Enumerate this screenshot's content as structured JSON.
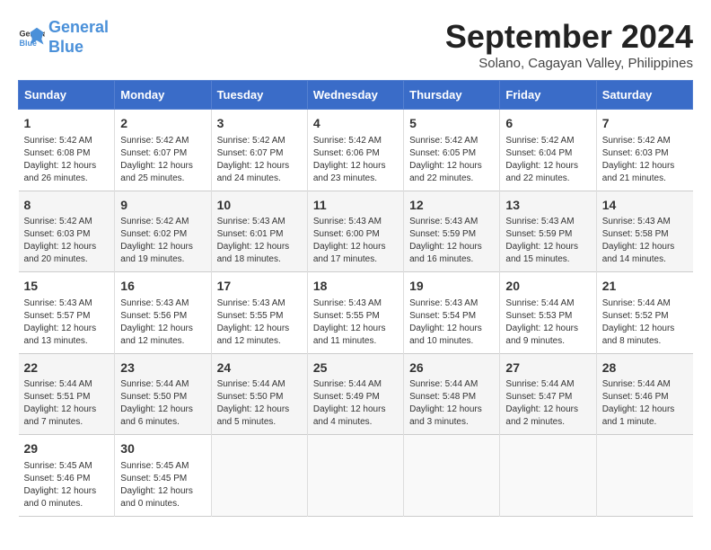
{
  "logo": {
    "line1": "General",
    "line2": "Blue"
  },
  "title": "September 2024",
  "subtitle": "Solano, Cagayan Valley, Philippines",
  "weekdays": [
    "Sunday",
    "Monday",
    "Tuesday",
    "Wednesday",
    "Thursday",
    "Friday",
    "Saturday"
  ],
  "weeks": [
    [
      {
        "day": 1,
        "sunrise": "5:42 AM",
        "sunset": "6:08 PM",
        "daylight": "12 hours and 26 minutes."
      },
      {
        "day": 2,
        "sunrise": "5:42 AM",
        "sunset": "6:07 PM",
        "daylight": "12 hours and 25 minutes."
      },
      {
        "day": 3,
        "sunrise": "5:42 AM",
        "sunset": "6:07 PM",
        "daylight": "12 hours and 24 minutes."
      },
      {
        "day": 4,
        "sunrise": "5:42 AM",
        "sunset": "6:06 PM",
        "daylight": "12 hours and 23 minutes."
      },
      {
        "day": 5,
        "sunrise": "5:42 AM",
        "sunset": "6:05 PM",
        "daylight": "12 hours and 22 minutes."
      },
      {
        "day": 6,
        "sunrise": "5:42 AM",
        "sunset": "6:04 PM",
        "daylight": "12 hours and 22 minutes."
      },
      {
        "day": 7,
        "sunrise": "5:42 AM",
        "sunset": "6:03 PM",
        "daylight": "12 hours and 21 minutes."
      }
    ],
    [
      {
        "day": 8,
        "sunrise": "5:42 AM",
        "sunset": "6:03 PM",
        "daylight": "12 hours and 20 minutes."
      },
      {
        "day": 9,
        "sunrise": "5:42 AM",
        "sunset": "6:02 PM",
        "daylight": "12 hours and 19 minutes."
      },
      {
        "day": 10,
        "sunrise": "5:43 AM",
        "sunset": "6:01 PM",
        "daylight": "12 hours and 18 minutes."
      },
      {
        "day": 11,
        "sunrise": "5:43 AM",
        "sunset": "6:00 PM",
        "daylight": "12 hours and 17 minutes."
      },
      {
        "day": 12,
        "sunrise": "5:43 AM",
        "sunset": "5:59 PM",
        "daylight": "12 hours and 16 minutes."
      },
      {
        "day": 13,
        "sunrise": "5:43 AM",
        "sunset": "5:59 PM",
        "daylight": "12 hours and 15 minutes."
      },
      {
        "day": 14,
        "sunrise": "5:43 AM",
        "sunset": "5:58 PM",
        "daylight": "12 hours and 14 minutes."
      }
    ],
    [
      {
        "day": 15,
        "sunrise": "5:43 AM",
        "sunset": "5:57 PM",
        "daylight": "12 hours and 13 minutes."
      },
      {
        "day": 16,
        "sunrise": "5:43 AM",
        "sunset": "5:56 PM",
        "daylight": "12 hours and 12 minutes."
      },
      {
        "day": 17,
        "sunrise": "5:43 AM",
        "sunset": "5:55 PM",
        "daylight": "12 hours and 12 minutes."
      },
      {
        "day": 18,
        "sunrise": "5:43 AM",
        "sunset": "5:55 PM",
        "daylight": "12 hours and 11 minutes."
      },
      {
        "day": 19,
        "sunrise": "5:43 AM",
        "sunset": "5:54 PM",
        "daylight": "12 hours and 10 minutes."
      },
      {
        "day": 20,
        "sunrise": "5:44 AM",
        "sunset": "5:53 PM",
        "daylight": "12 hours and 9 minutes."
      },
      {
        "day": 21,
        "sunrise": "5:44 AM",
        "sunset": "5:52 PM",
        "daylight": "12 hours and 8 minutes."
      }
    ],
    [
      {
        "day": 22,
        "sunrise": "5:44 AM",
        "sunset": "5:51 PM",
        "daylight": "12 hours and 7 minutes."
      },
      {
        "day": 23,
        "sunrise": "5:44 AM",
        "sunset": "5:50 PM",
        "daylight": "12 hours and 6 minutes."
      },
      {
        "day": 24,
        "sunrise": "5:44 AM",
        "sunset": "5:50 PM",
        "daylight": "12 hours and 5 minutes."
      },
      {
        "day": 25,
        "sunrise": "5:44 AM",
        "sunset": "5:49 PM",
        "daylight": "12 hours and 4 minutes."
      },
      {
        "day": 26,
        "sunrise": "5:44 AM",
        "sunset": "5:48 PM",
        "daylight": "12 hours and 3 minutes."
      },
      {
        "day": 27,
        "sunrise": "5:44 AM",
        "sunset": "5:47 PM",
        "daylight": "12 hours and 2 minutes."
      },
      {
        "day": 28,
        "sunrise": "5:44 AM",
        "sunset": "5:46 PM",
        "daylight": "12 hours and 1 minute."
      }
    ],
    [
      {
        "day": 29,
        "sunrise": "5:45 AM",
        "sunset": "5:46 PM",
        "daylight": "12 hours and 0 minutes."
      },
      {
        "day": 30,
        "sunrise": "5:45 AM",
        "sunset": "5:45 PM",
        "daylight": "12 hours and 0 minutes."
      },
      null,
      null,
      null,
      null,
      null
    ]
  ]
}
